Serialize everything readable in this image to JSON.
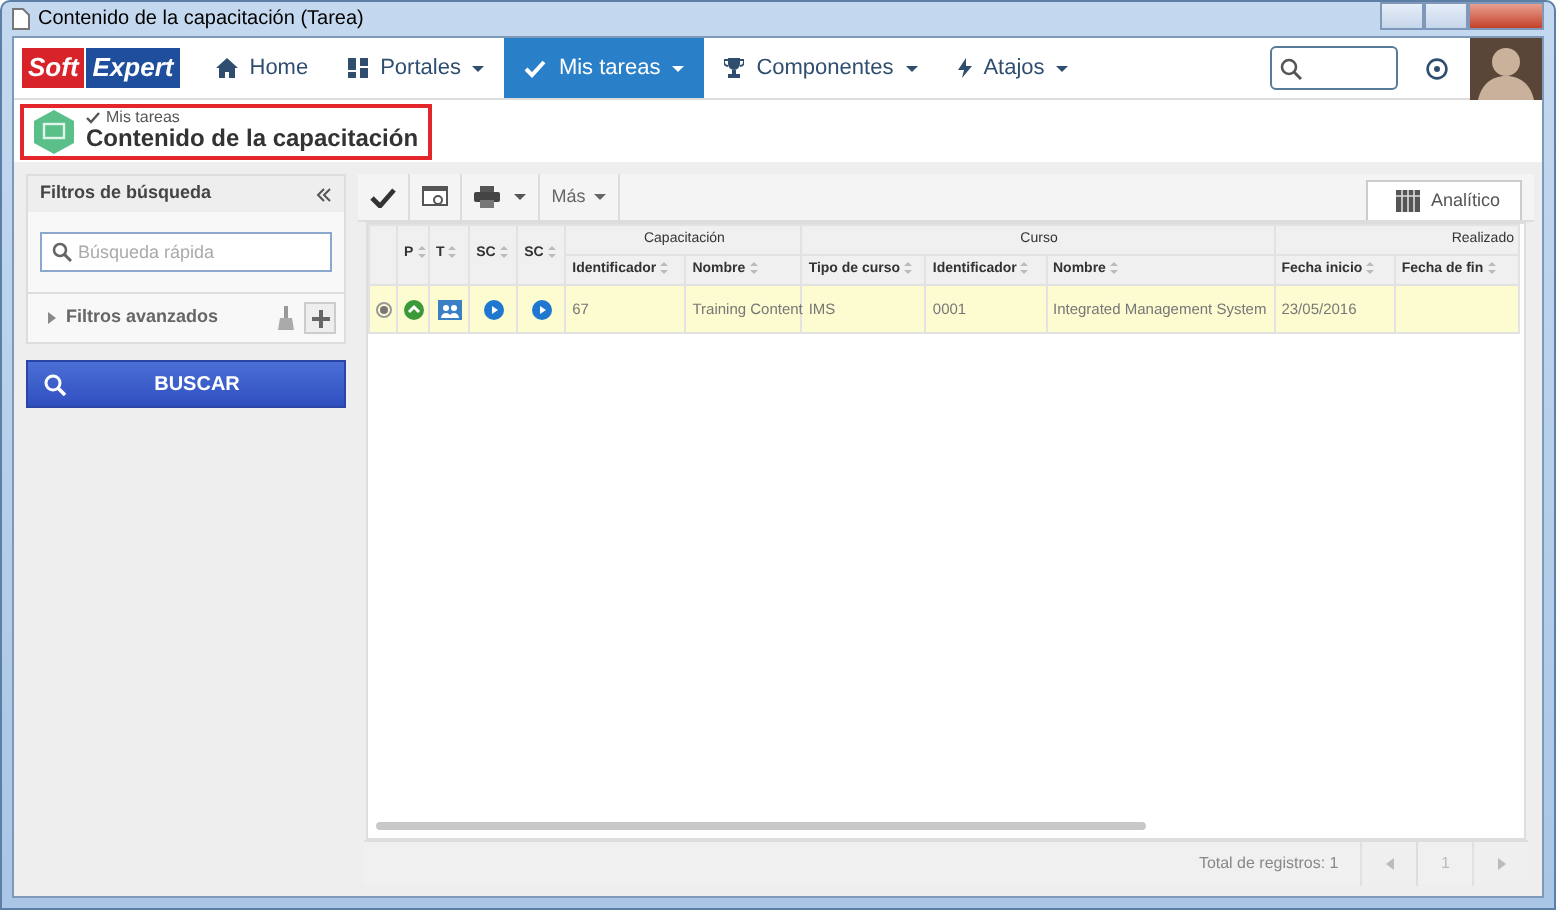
{
  "window": {
    "title": "Contenido de la capacitación (Tarea)"
  },
  "logo": {
    "left": "Soft",
    "right": "Expert"
  },
  "navbar": {
    "items": [
      {
        "label": "Home",
        "caret": false,
        "selected": false
      },
      {
        "label": "Portales",
        "caret": true,
        "selected": false
      },
      {
        "label": "Mis tareas",
        "caret": true,
        "selected": true
      },
      {
        "label": "Componentes",
        "caret": true,
        "selected": false
      },
      {
        "label": "Atajos",
        "caret": true,
        "selected": false
      }
    ]
  },
  "header": {
    "breadcrumb": "Mis tareas",
    "title": "Contenido de la capacitación"
  },
  "sidebar": {
    "title": "Filtros de búsqueda",
    "search": {
      "placeholder": "Búsqueda rápida"
    },
    "advanced": "Filtros avanzados",
    "button": "BUSCAR"
  },
  "toolbar": {
    "more": "Más"
  },
  "view_tab": {
    "label": "Analítico",
    "selected": true
  },
  "table": {
    "groups": [
      {
        "label": "Capacitación"
      },
      {
        "label": "Curso"
      },
      {
        "label": "Realizado"
      }
    ],
    "icon_columns": [
      {
        "label": "P"
      },
      {
        "label": "T"
      },
      {
        "label": "SC"
      },
      {
        "label": "SC"
      }
    ],
    "columns": [
      {
        "label": "Identificador"
      },
      {
        "label": "Nombre"
      },
      {
        "label": "Tipo de curso"
      },
      {
        "label": "Identificador"
      },
      {
        "label": "Nombre"
      },
      {
        "label": "Fecha inicio"
      },
      {
        "label": "Fecha de fin"
      }
    ],
    "rows": [
      {
        "selected": true,
        "cells": [
          "67",
          "Training Content",
          "IMS",
          "0001",
          "Integrated Management System",
          "23/05/2016"
        ]
      }
    ]
  },
  "footer": {
    "total": "Total de registros: 1",
    "page": "1"
  }
}
